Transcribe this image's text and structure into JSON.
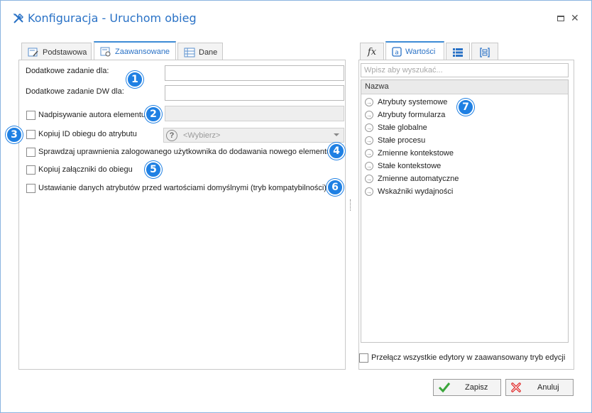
{
  "window": {
    "title": "Konfiguracja - Uruchom obieg",
    "title_icon": "tools-icon",
    "accent_color": "#2a72c6"
  },
  "left_tabs": [
    {
      "label": "Podstawowa",
      "icon": "edit-form-icon",
      "active": false
    },
    {
      "label": "Zaawansowane",
      "icon": "settings-form-icon",
      "active": true
    },
    {
      "label": "Dane",
      "icon": "table-icon",
      "active": false
    }
  ],
  "form": {
    "additional_task_label": "Dodatkowe zadanie dla:",
    "additional_task_value": "",
    "additional_task_dw_label": "Dodatkowe zadanie DW dla:",
    "additional_task_dw_value": "",
    "overwrite_author_label": "Nadpisywanie autora elementu",
    "overwrite_author_checked": false,
    "overwrite_author_value": "",
    "copy_id_label": "Kopiuj ID obiegu do atrybutu",
    "copy_id_checked": false,
    "copy_id_select_placeholder": "<Wybierz>",
    "check_permissions_label": "Sprawdzaj uprawnienia zalogowanego użytkownika do dodawania nowego elementu",
    "check_permissions_checked": false,
    "copy_attachments_label": "Kopiuj załączniki do obiegu",
    "copy_attachments_checked": false,
    "set_attributes_label": "Ustawianie danych atrybutów przed wartościami domyślnymi (tryb kompatybilności)",
    "set_attributes_checked": false
  },
  "badges": [
    "1",
    "2",
    "3",
    "4",
    "5",
    "6",
    "7"
  ],
  "right_tabs": [
    {
      "label": "",
      "icon": "function-fx-icon",
      "active": false
    },
    {
      "label": "Wartości",
      "icon": "values-icon",
      "active": true
    },
    {
      "label": "",
      "icon": "list-icon",
      "active": false
    },
    {
      "label": "",
      "icon": "form-bracket-icon",
      "active": false
    }
  ],
  "values_panel": {
    "search_placeholder": "Wpisz aby wyszukać...",
    "column_header": "Nazwa",
    "items": [
      "Atrybuty systemowe",
      "Atrybuty formularza",
      "Stałe globalne",
      "Stałe procesu",
      "Zmienne kontekstowe",
      "Stałe kontekstowe",
      "Zmienne automatyczne",
      "Wskaźniki wydajności"
    ],
    "advanced_mode_label": "Przełącz wszystkie edytory w zaawansowany tryb edycji",
    "advanced_mode_checked": false
  },
  "buttons": {
    "save_label": "Zapisz",
    "cancel_label": "Anuluj"
  }
}
